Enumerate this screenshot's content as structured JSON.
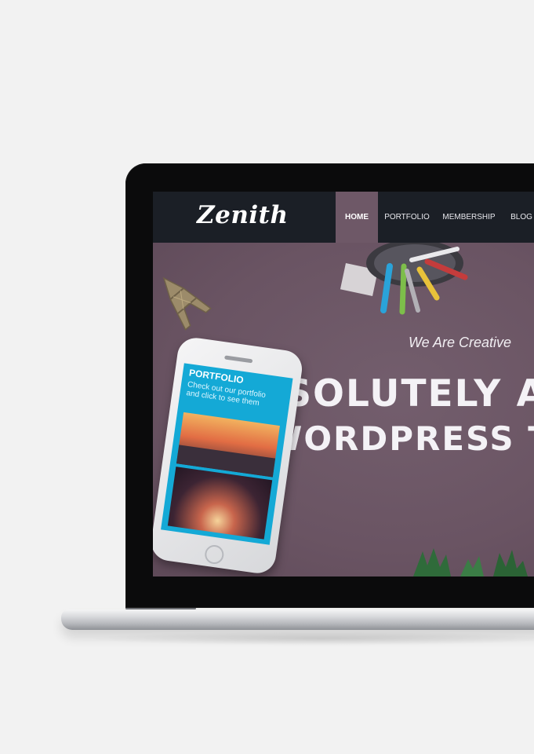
{
  "site": {
    "logo": "Zenith",
    "nav": [
      {
        "label": "HOME",
        "active": true
      },
      {
        "label": "PORTFOLIO",
        "active": false
      },
      {
        "label": "MEMBERSHIP",
        "active": false
      },
      {
        "label": "BLOG",
        "active": false
      }
    ]
  },
  "hero": {
    "tagline": "We Are Creative",
    "headline_line1": "ABSOLUTELY AW",
    "headline_line2": "WORDPRESS T"
  },
  "phone": {
    "title": "PORTFOLIO",
    "subtitle": "Check out our portfolio and click to see them"
  },
  "colors": {
    "nav_bg": "#1b1f26",
    "accent": "#6e5867",
    "hero_bg": "#6a5463",
    "phone_screen": "#14a9d6"
  },
  "icons": [
    "eiffel-tower-icon",
    "pencil-cup-icon",
    "plant-icon"
  ]
}
